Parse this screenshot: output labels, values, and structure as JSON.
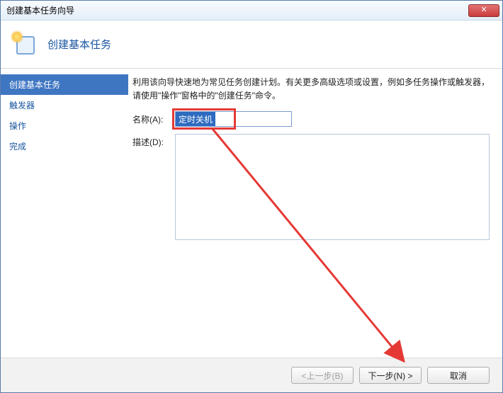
{
  "window": {
    "title": "创建基本任务向导",
    "close_glyph": "✕"
  },
  "header": {
    "title": "创建基本任务"
  },
  "sidebar": {
    "items": [
      {
        "label": "创建基本任务",
        "active": true
      },
      {
        "label": "触发器",
        "active": false
      },
      {
        "label": "操作",
        "active": false
      },
      {
        "label": "完成",
        "active": false
      }
    ]
  },
  "content": {
    "intro": "利用该向导快速地为常见任务创建计划。有关更多高级选项或设置，例如多任务操作或触发器，请使用\"操作\"窗格中的\"创建任务\"命令。",
    "name_label": "名称(A):",
    "name_value": "定时关机",
    "desc_label": "描述(D):",
    "desc_value": ""
  },
  "footer": {
    "back": "<上一步(B)",
    "next": "下一步(N) >",
    "cancel": "取消"
  }
}
